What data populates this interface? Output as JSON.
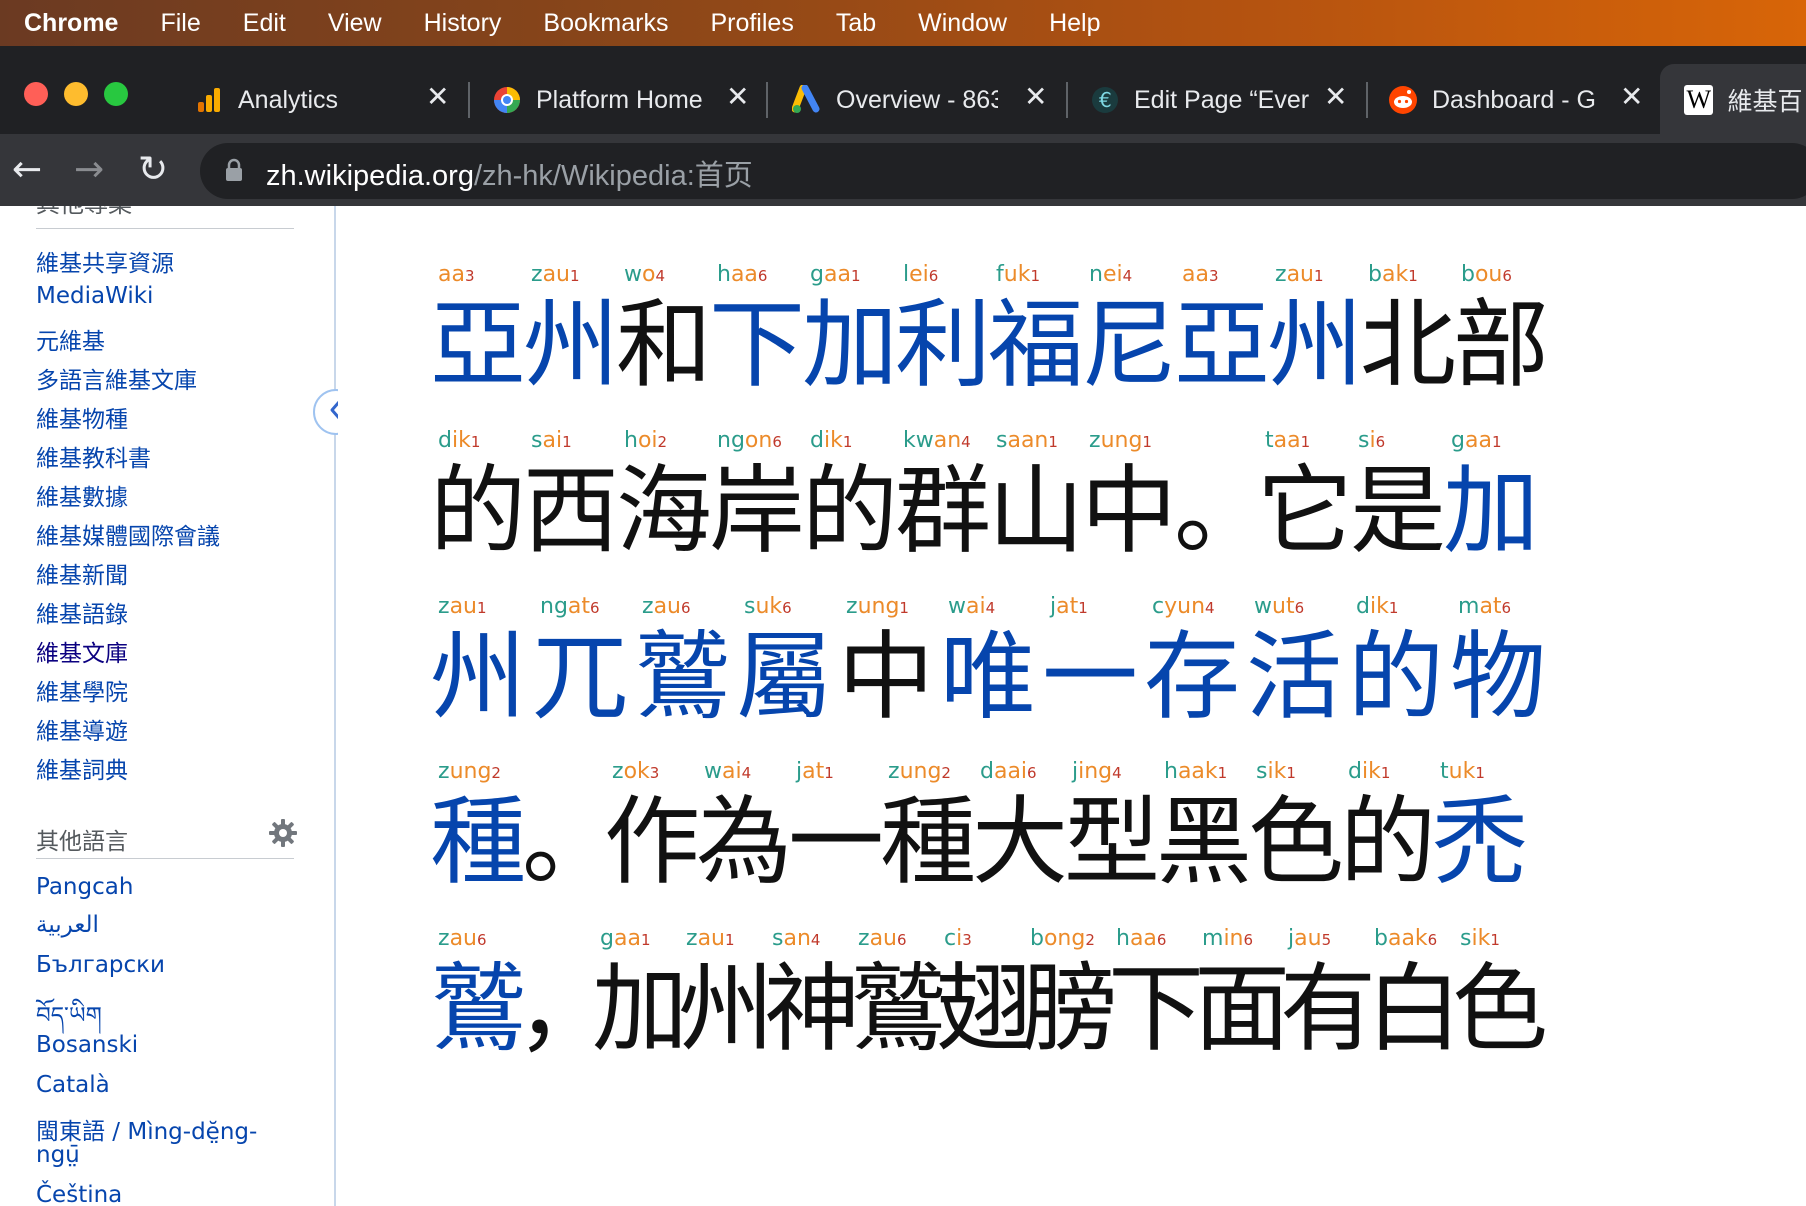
{
  "menubar": {
    "items": [
      "Chrome",
      "File",
      "Edit",
      "View",
      "History",
      "Bookmarks",
      "Profiles",
      "Tab",
      "Window",
      "Help"
    ]
  },
  "tabs": [
    {
      "title": "Analytics",
      "icon": "analytics-icon"
    },
    {
      "title": "Platform Home",
      "icon": "platform-home-icon"
    },
    {
      "title": "Overview - 863",
      "icon": "google-ads-icon"
    },
    {
      "title": "Edit Page “Ever",
      "icon": "elementor-icon"
    },
    {
      "title": "Dashboard - Go",
      "icon": "reddit-icon"
    },
    {
      "title": "維基百",
      "icon": "wikipedia-icon",
      "active": true
    }
  ],
  "toolbar": {
    "url_host": "zh.wikipedia.org",
    "url_path": "/zh-hk/Wikipedia:首页"
  },
  "sidebar": {
    "cut_heading": "其他專案",
    "projects": [
      "維基共享資源",
      "MediaWiki",
      "元維基",
      "多語言維基文庫",
      "維基物種",
      "維基教科書",
      "維基數據",
      "維基媒體國際會議",
      "維基新聞",
      "維基語錄",
      "維基文庫",
      "維基學院",
      "維基導遊",
      "維基詞典"
    ],
    "languages_heading": "其他語言",
    "languages": [
      "Pangcah",
      "العربية",
      "Български",
      "བོད་ཡིག",
      "Bosanski",
      "Català",
      "閩東語 / Mìng-dĕ̤ng-",
      "ngṳ̄",
      "Čeština"
    ]
  },
  "content": {
    "rows": [
      [
        {
          "han": "亞",
          "i": "",
          "f": "aa",
          "t": "3",
          "link": true
        },
        {
          "han": "州",
          "i": "z",
          "f": "au",
          "t": "1",
          "link": true
        },
        {
          "han": "和",
          "i": "w",
          "f": "o",
          "t": "4",
          "link": false
        },
        {
          "han": "下",
          "i": "h",
          "f": "aa",
          "t": "6",
          "link": true
        },
        {
          "han": "加",
          "i": "g",
          "f": "aa",
          "t": "1",
          "link": true
        },
        {
          "han": "利",
          "i": "l",
          "f": "ei",
          "t": "6",
          "link": true
        },
        {
          "han": "福",
          "i": "f",
          "f": "uk",
          "t": "1",
          "link": true
        },
        {
          "han": "尼",
          "i": "n",
          "f": "ei",
          "t": "4",
          "link": true
        },
        {
          "han": "亞",
          "i": "",
          "f": "aa",
          "t": "3",
          "link": true
        },
        {
          "han": "州",
          "i": "z",
          "f": "au",
          "t": "1",
          "link": true
        },
        {
          "han": "北",
          "i": "b",
          "f": "ak",
          "t": "1",
          "link": false
        },
        {
          "han": "部",
          "i": "b",
          "f": "ou",
          "t": "6",
          "link": false
        }
      ],
      [
        {
          "han": "的",
          "i": "d",
          "f": "ik",
          "t": "1",
          "link": false
        },
        {
          "han": "西",
          "i": "s",
          "f": "ai",
          "t": "1",
          "link": false
        },
        {
          "han": "海",
          "i": "h",
          "f": "oi",
          "t": "2",
          "link": false
        },
        {
          "han": "岸",
          "i": "ng",
          "f": "on",
          "t": "6",
          "link": false
        },
        {
          "han": "的",
          "i": "d",
          "f": "ik",
          "t": "1",
          "link": false
        },
        {
          "han": "群",
          "i": "kw",
          "f": "an",
          "t": "4",
          "link": false
        },
        {
          "han": "山",
          "i": "s",
          "f": "aan",
          "t": "1",
          "link": false
        },
        {
          "han": "中",
          "i": "z",
          "f": "ung",
          "t": "1",
          "link": false
        },
        {
          "han": "。",
          "i": "",
          "f": "",
          "t": "",
          "link": false
        },
        {
          "han": "它",
          "i": "t",
          "f": "aa",
          "t": "1",
          "link": false
        },
        {
          "han": "是",
          "i": "s",
          "f": "i",
          "t": "6",
          "link": false
        },
        {
          "han": "加",
          "i": "g",
          "f": "aa",
          "t": "1",
          "link": true
        }
      ],
      [
        {
          "han": "州",
          "i": "z",
          "f": "au",
          "t": "1",
          "link": true
        },
        {
          "han": "兀",
          "i": "ng",
          "f": "at",
          "t": "6",
          "link": true
        },
        {
          "han": "鷲",
          "i": "z",
          "f": "au",
          "t": "6",
          "link": true
        },
        {
          "han": "屬",
          "i": "s",
          "f": "uk",
          "t": "6",
          "link": true
        },
        {
          "han": "中",
          "i": "z",
          "f": "ung",
          "t": "1",
          "link": false
        },
        {
          "han": "唯",
          "i": "w",
          "f": "ai",
          "t": "4",
          "link": true
        },
        {
          "han": "一",
          "i": "j",
          "f": "at",
          "t": "1",
          "link": true
        },
        {
          "han": "存",
          "i": "c",
          "f": "yun",
          "t": "4",
          "link": true
        },
        {
          "han": "活",
          "i": "w",
          "f": "ut",
          "t": "6",
          "link": true
        },
        {
          "han": "的",
          "i": "d",
          "f": "ik",
          "t": "1",
          "link": true
        },
        {
          "han": "物",
          "i": "m",
          "f": "at",
          "t": "6",
          "link": true
        }
      ],
      [
        {
          "han": "種",
          "i": "z",
          "f": "ung",
          "t": "2",
          "link": true
        },
        {
          "han": "。",
          "i": "",
          "f": "",
          "t": "",
          "link": false
        },
        {
          "han": "作",
          "i": "z",
          "f": "ok",
          "t": "3",
          "link": false
        },
        {
          "han": "為",
          "i": "w",
          "f": "ai",
          "t": "4",
          "link": false
        },
        {
          "han": "一",
          "i": "j",
          "f": "at",
          "t": "1",
          "link": false
        },
        {
          "han": "種",
          "i": "z",
          "f": "ung",
          "t": "2",
          "link": false
        },
        {
          "han": "大",
          "i": "d",
          "f": "aai",
          "t": "6",
          "link": false
        },
        {
          "han": "型",
          "i": "j",
          "f": "ing",
          "t": "4",
          "link": false
        },
        {
          "han": "黑",
          "i": "h",
          "f": "aak",
          "t": "1",
          "link": false
        },
        {
          "han": "色",
          "i": "s",
          "f": "ik",
          "t": "1",
          "link": false
        },
        {
          "han": "的",
          "i": "d",
          "f": "ik",
          "t": "1",
          "link": false
        },
        {
          "han": "禿",
          "i": "t",
          "f": "uk",
          "t": "1",
          "link": true
        }
      ],
      [
        {
          "han": "鷲",
          "i": "z",
          "f": "au",
          "t": "6",
          "link": true
        },
        {
          "han": "，",
          "i": "",
          "f": "",
          "t": "",
          "link": false
        },
        {
          "han": "加",
          "i": "g",
          "f": "aa",
          "t": "1",
          "link": false
        },
        {
          "han": "州",
          "i": "z",
          "f": "au",
          "t": "1",
          "link": false
        },
        {
          "han": "神",
          "i": "s",
          "f": "an",
          "t": "4",
          "link": false
        },
        {
          "han": "鷲",
          "i": "z",
          "f": "au",
          "t": "6",
          "link": false
        },
        {
          "han": "翅",
          "i": "c",
          "f": "i",
          "t": "3",
          "link": false
        },
        {
          "han": "膀",
          "i": "b",
          "f": "ong",
          "t": "2",
          "link": false
        },
        {
          "han": "下",
          "i": "h",
          "f": "aa",
          "t": "6",
          "link": false
        },
        {
          "han": "面",
          "i": "m",
          "f": "in",
          "t": "6",
          "link": false
        },
        {
          "han": "有",
          "i": "j",
          "f": "au",
          "t": "5",
          "link": false
        },
        {
          "han": "白",
          "i": "b",
          "f": "aak",
          "t": "6",
          "link": false
        },
        {
          "han": "色",
          "i": "s",
          "f": "ik",
          "t": "1",
          "link": false
        }
      ]
    ]
  },
  "colors": {
    "link": "#0645ad",
    "initial": "#2b9c8b",
    "final": "#ec8b2a",
    "tone": "#c0392b"
  }
}
